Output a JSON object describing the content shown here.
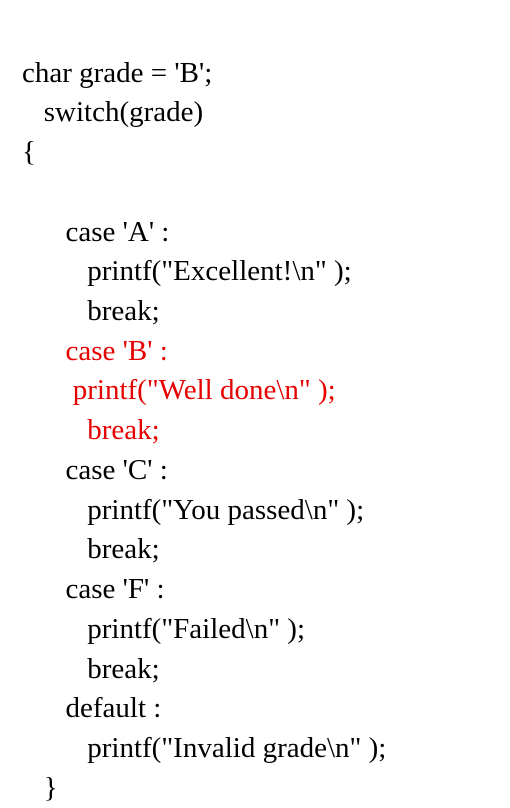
{
  "code": {
    "line1": "char grade = 'B';",
    "line2": "   switch(grade)",
    "line3": "{",
    "line4": "",
    "line5": "      case 'A' :",
    "line6": "         printf(\"Excellent!\\n\" );",
    "line7": "         break;",
    "line8": "      case 'B' :",
    "line9": "       printf(\"Well done\\n\" );",
    "line10": "         break;",
    "line11": "      case 'C' :",
    "line12": "         printf(\"You passed\\n\" );",
    "line13": "         break;",
    "line14": "      case 'F' :",
    "line15": "         printf(\"Failed\\n\" );",
    "line16": "         break;",
    "line17": "      default :",
    "line18": "         printf(\"Invalid grade\\n\" );",
    "line19": "   }"
  }
}
